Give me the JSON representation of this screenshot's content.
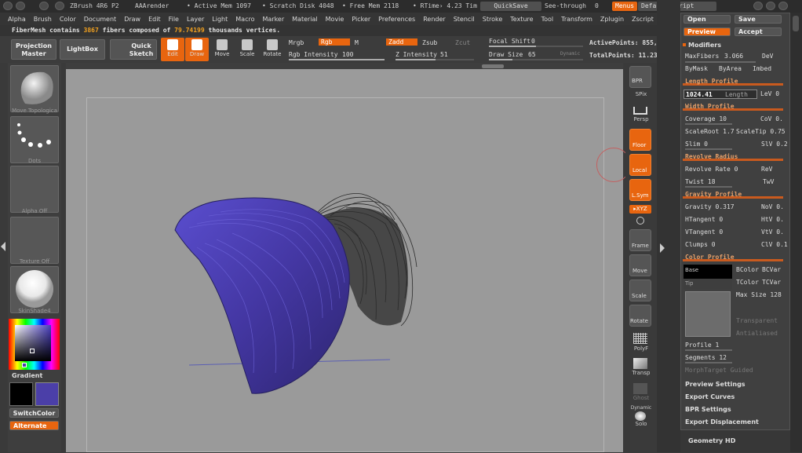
{
  "titlebar": {
    "app": "ZBrush 4R6 P2",
    "render": "AAArender",
    "active_mem": "• Active Mem 1097",
    "scratch": "• Scratch Disk 4048",
    "free_mem": "• Free Mem 2118",
    "rtime": "• RTime› 4.23 Tim",
    "quicksave": "QuickSave",
    "seethrough": "See-through",
    "seethrough_val": "0",
    "menus": "Menus",
    "script": "DefaultZScript"
  },
  "menubar": [
    "Alpha",
    "Brush",
    "Color",
    "Document",
    "Draw",
    "Edit",
    "File",
    "Layer",
    "Light",
    "Macro",
    "Marker",
    "Material",
    "Movie",
    "Picker",
    "Preferences",
    "Render",
    "Stencil",
    "Stroke",
    "Texture",
    "Tool",
    "Transform",
    "Zplugin",
    "Zscript"
  ],
  "info": {
    "prefix": "FiberMesh contains",
    "fibers": "3867",
    "mid": "fibers composed of",
    "verts": "79.74199",
    "suffix": "thousands vertices."
  },
  "toolbar": {
    "projection": "Projection Master",
    "lightbox": "LightBox",
    "quicksketch": "Quick Sketch",
    "edit": "Edit",
    "draw": "Draw",
    "move": "Move",
    "scale": "Scale",
    "rotate": "Rotate",
    "mrgb": "Mrgb",
    "rgb": "Rgb",
    "m": "M",
    "zadd": "Zadd",
    "zsub": "Zsub",
    "zcut": "Zcut",
    "rgb_int_label": "Rgb Intensity",
    "rgb_int": "100",
    "z_int_label": "Z Intensity",
    "z_int": "51",
    "focal_label": "Focal Shift",
    "focal": "0",
    "drawsize_label": "Draw Size",
    "drawsize": "65",
    "dynamic": "Dynamic",
    "active_points": "ActivePoints: 855,",
    "total_points": "TotalPoints: 11.23"
  },
  "leftpanel": {
    "brush_cap": "Move Topologica",
    "dots_cap": "Dots",
    "alpha_cap": "Alpha Off",
    "texture_cap": "Texture Off",
    "material_cap": "SkinShade4",
    "gradient": "Gradient",
    "switchcolor": "SwitchColor",
    "alternate": "Alternate"
  },
  "shelf": {
    "bpr": "BPR",
    "spix": "SPix",
    "persp": "Persp",
    "floor": "Floor",
    "local": "Local",
    "lsym": "L.Sym",
    "xyz": "▸XYZ",
    "frame": "Frame",
    "move": "Move",
    "scale": "Scale",
    "rotate": "Rotate",
    "polyf": "PolyF",
    "transp": "Transp",
    "ghost": "Ghost",
    "dynamic": "Dynamic",
    "solo": "Solo"
  },
  "fiber": {
    "open": "Open",
    "save": "Save",
    "preview": "Preview",
    "accept": "Accept",
    "modifiers": "Modifiers",
    "maxfibers_label": "MaxFibers",
    "maxfibers": "3.066",
    "dev": "DeV",
    "bymask": "ByMask",
    "byarea": "ByArea",
    "imbed": "Imbed",
    "length_profile": "Length Profile",
    "length_val": "1024.41",
    "length_label": "Length",
    "lev": "LeV 0",
    "width_profile": "Width Profile",
    "coverage": "Coverage 10",
    "cov": "CoV 0.",
    "scaleroot": "ScaleRoot 1.7",
    "scaletip": "ScaleTip 0.75",
    "slim": "Slim 0",
    "slv": "SlV 0.2",
    "revolve_radius": "Revolve Radius",
    "revolve_rate": "Revolve Rate 0",
    "rev": "ReV",
    "twist": "Twist 18",
    "twv": "TwV",
    "gravity_profile": "Gravity Profile",
    "gravity": "Gravity 0.317",
    "nov": "NoV 0.",
    "htangent": "HTangent 0",
    "htv": "HtV 0.",
    "vtangent": "VTangent 0",
    "vtv": "VtV 0.",
    "clumps": "Clumps 0",
    "clv": "ClV 0.1",
    "color_profile": "Color Profile",
    "base": "Base",
    "tip": "Tip",
    "bcolor": "BColor",
    "bcvar": "BCVar",
    "tcolor": "TColor",
    "tcvar": "TCVar",
    "maxsize": "Max Size 128",
    "transparent": "Transparent",
    "antialiased": "Antialiased",
    "profile": "Profile 1",
    "segments": "Segments 12",
    "morph": "MorphTarget Guided",
    "preview_settings": "Preview Settings",
    "export_curves": "Export Curves",
    "bpr_settings": "BPR Settings",
    "export_disp": "Export Displacement",
    "geometry_hd": "Geometry HD"
  },
  "colors": {
    "accent": "#e8650f",
    "fiber_blue": "#4b3fa8",
    "canvas": "#9b9b9b"
  }
}
